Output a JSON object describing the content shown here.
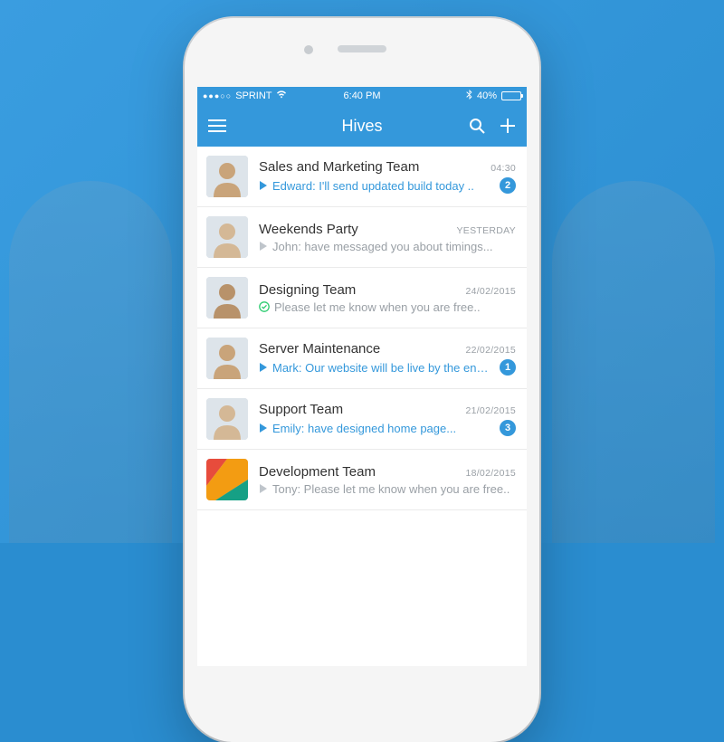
{
  "status_bar": {
    "carrier": "SPRINT",
    "time": "6:40 PM",
    "battery_pct": "40%"
  },
  "nav": {
    "title": "Hives"
  },
  "chats": [
    {
      "title": "Sales and Marketing Team",
      "timestamp": "04:30",
      "preview": "Edward: I'll send updated build today ..",
      "unread": true,
      "icon": "play",
      "badge": "2",
      "avatar": "person1"
    },
    {
      "title": "Weekends Party",
      "timestamp": "YESTERDAY",
      "preview": "John: have messaged you about timings...",
      "unread": false,
      "icon": "play",
      "badge": null,
      "avatar": "person2"
    },
    {
      "title": "Designing Team",
      "timestamp": "24/02/2015",
      "preview": "Please let me know when you are free..",
      "unread": false,
      "icon": "check",
      "badge": null,
      "avatar": "person3"
    },
    {
      "title": "Server Maintenance",
      "timestamp": "22/02/2015",
      "preview": "Mark: Our website will be live by the end...",
      "unread": true,
      "icon": "play",
      "badge": "1",
      "avatar": "person4"
    },
    {
      "title": "Support Team",
      "timestamp": "21/02/2015",
      "preview": "Emily: have designed home page...",
      "unread": true,
      "icon": "play",
      "badge": "3",
      "avatar": "person5"
    },
    {
      "title": "Development Team",
      "timestamp": "18/02/2015",
      "preview": "Tony: Please let me know when you are free..",
      "unread": false,
      "icon": "play",
      "badge": null,
      "avatar": "logo"
    }
  ],
  "colors": {
    "primary": "#3498db",
    "bg": "#2a8dd0"
  }
}
